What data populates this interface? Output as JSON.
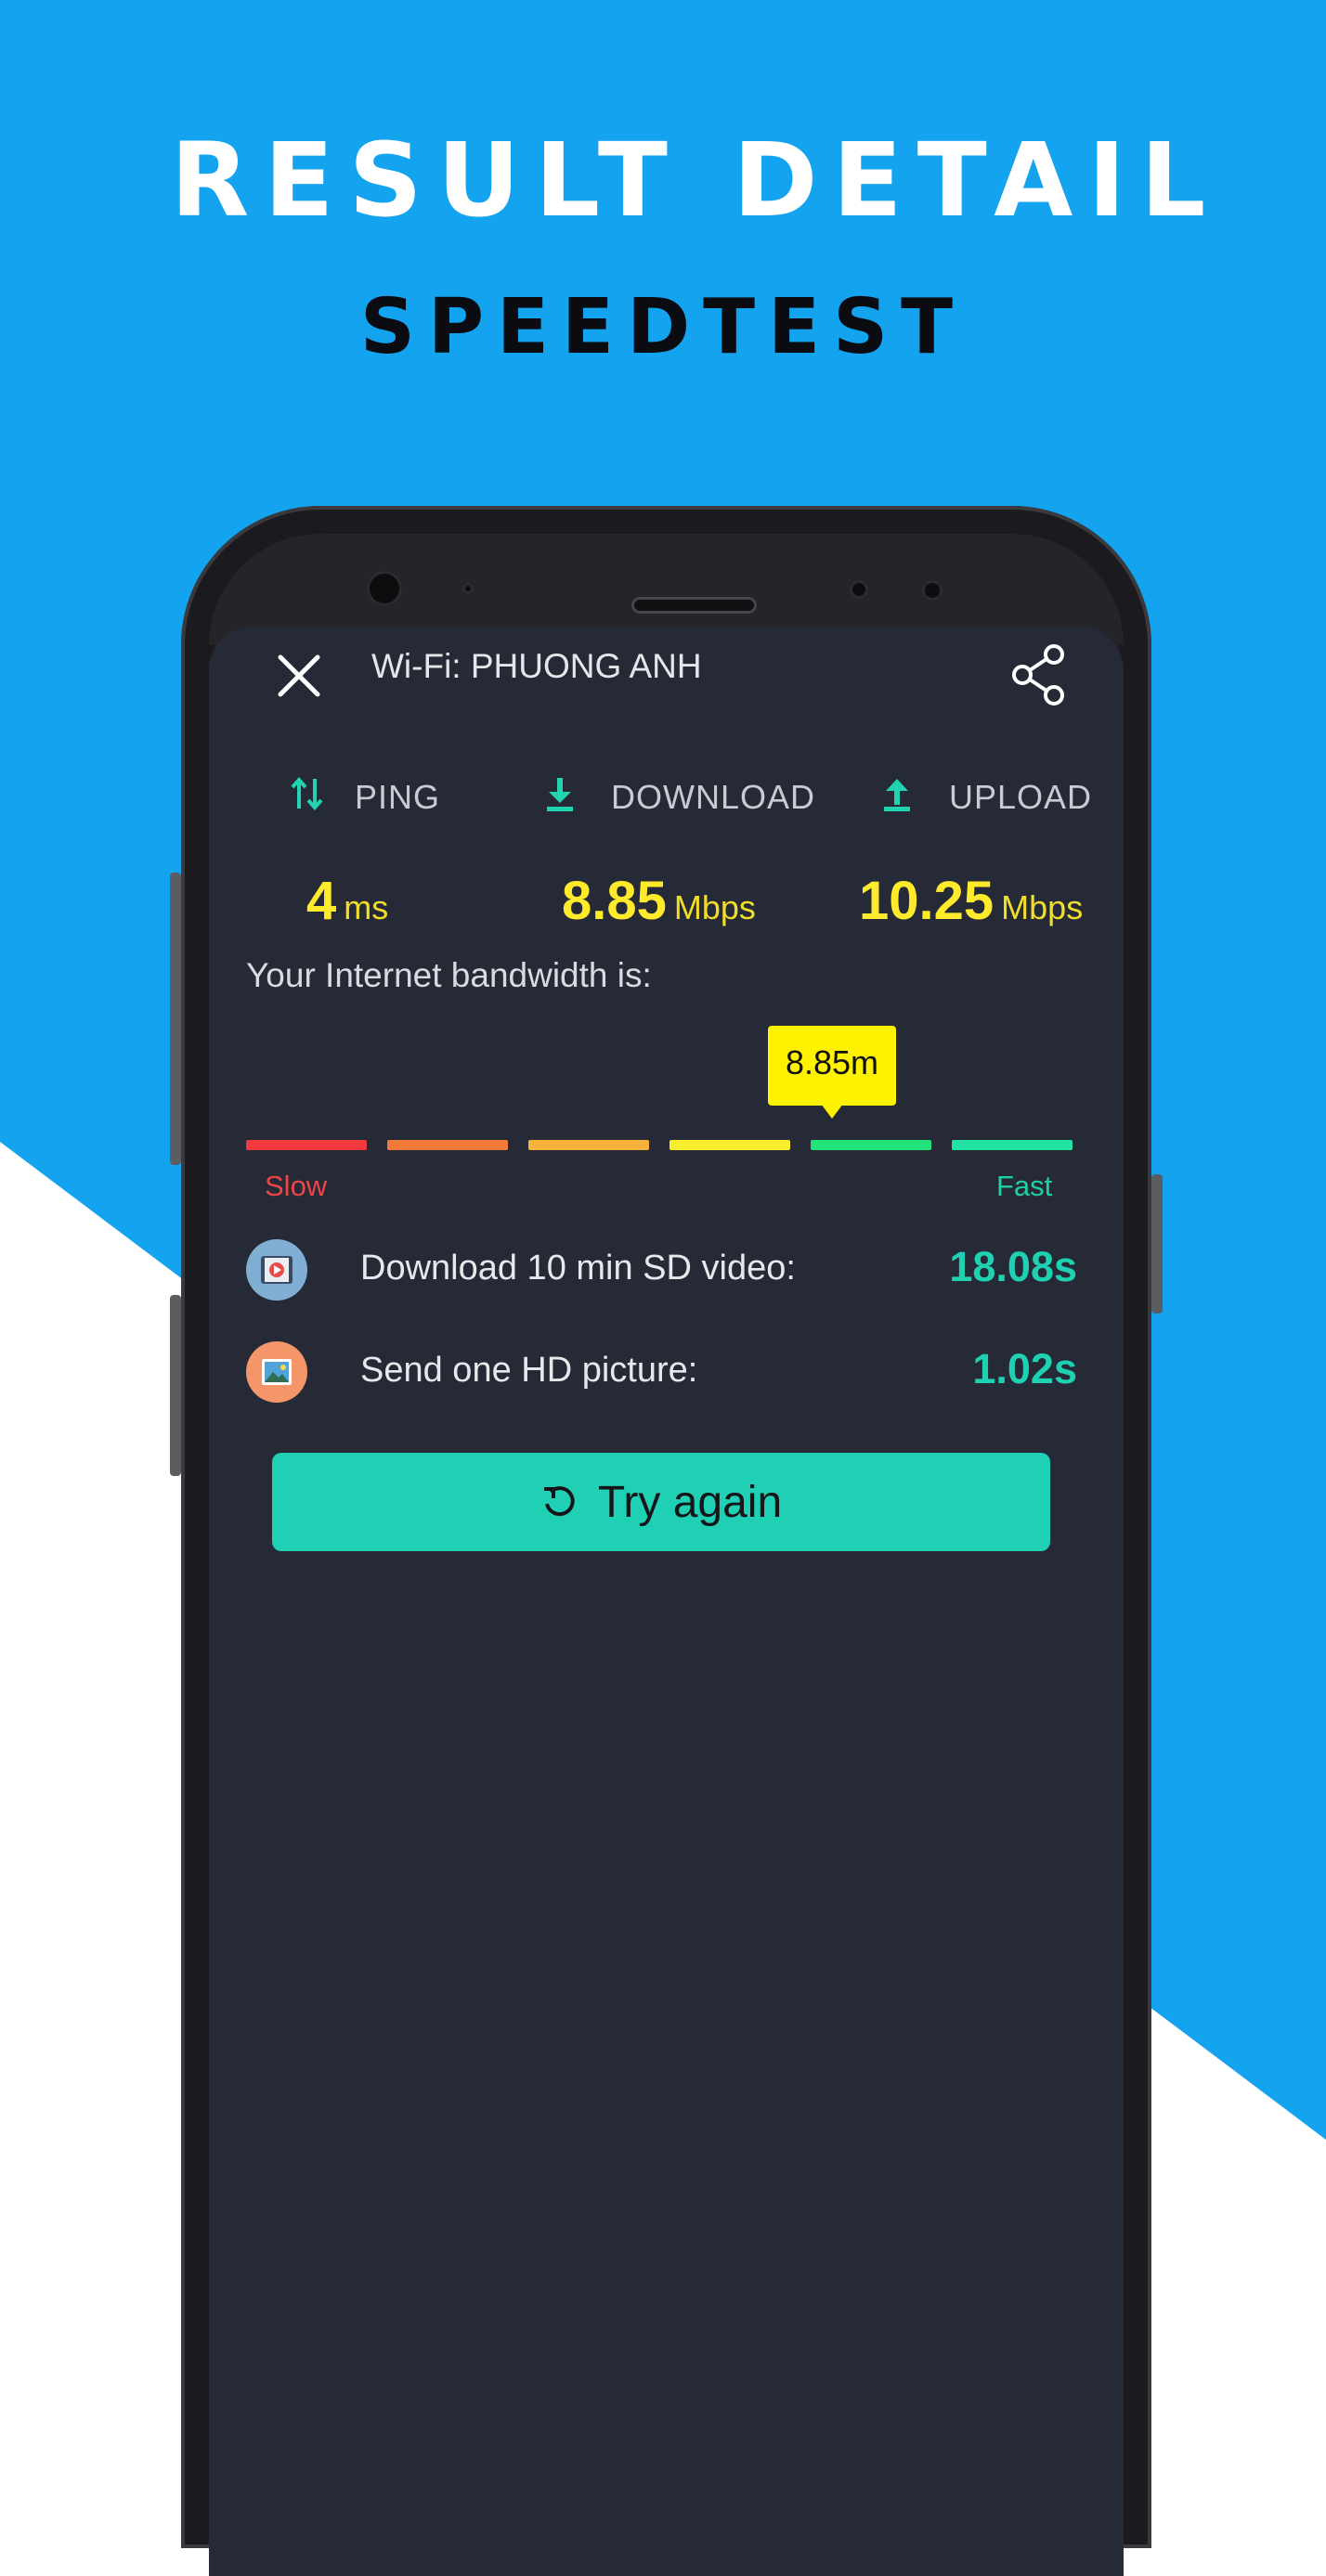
{
  "promo": {
    "title": "RESULT DETAIL",
    "subtitle": "SPEEDTEST"
  },
  "colors": {
    "background_blue": "#13a3ef",
    "screen_bg": "#252a36",
    "accent_teal": "#20d0b4",
    "value_yellow": "#ffea2b"
  },
  "header": {
    "ssid": "Wi-Fi: PHUONG ANH",
    "close_icon": "close-icon",
    "share_icon": "share-icon"
  },
  "metrics": [
    {
      "label": "PING",
      "icon": "ping-arrows-icon",
      "value": "4",
      "unit": "ms"
    },
    {
      "label": "DOWNLOAD",
      "icon": "download-icon",
      "value": "8.85",
      "unit": "Mbps"
    },
    {
      "label": "UPLOAD",
      "icon": "upload-icon",
      "value": "10.25",
      "unit": "Mbps"
    }
  ],
  "bandwidth": {
    "label": "Your Internet bandwidth is:",
    "indicator": "8.85m",
    "slow_label": "Slow",
    "fast_label": "Fast",
    "segment_colors": [
      "#f2393e",
      "#f47a3a",
      "#f6b23a",
      "#f9ee2e",
      "#22e37b",
      "#22e3a2"
    ]
  },
  "estimates": [
    {
      "label": "Download 10 min SD video:",
      "value": "18.08s",
      "icon": "video-icon"
    },
    {
      "label": "Send one HD picture:",
      "value": "1.02s",
      "icon": "picture-icon"
    }
  ],
  "retry": {
    "label": "Try again",
    "icon": "refresh-icon"
  }
}
